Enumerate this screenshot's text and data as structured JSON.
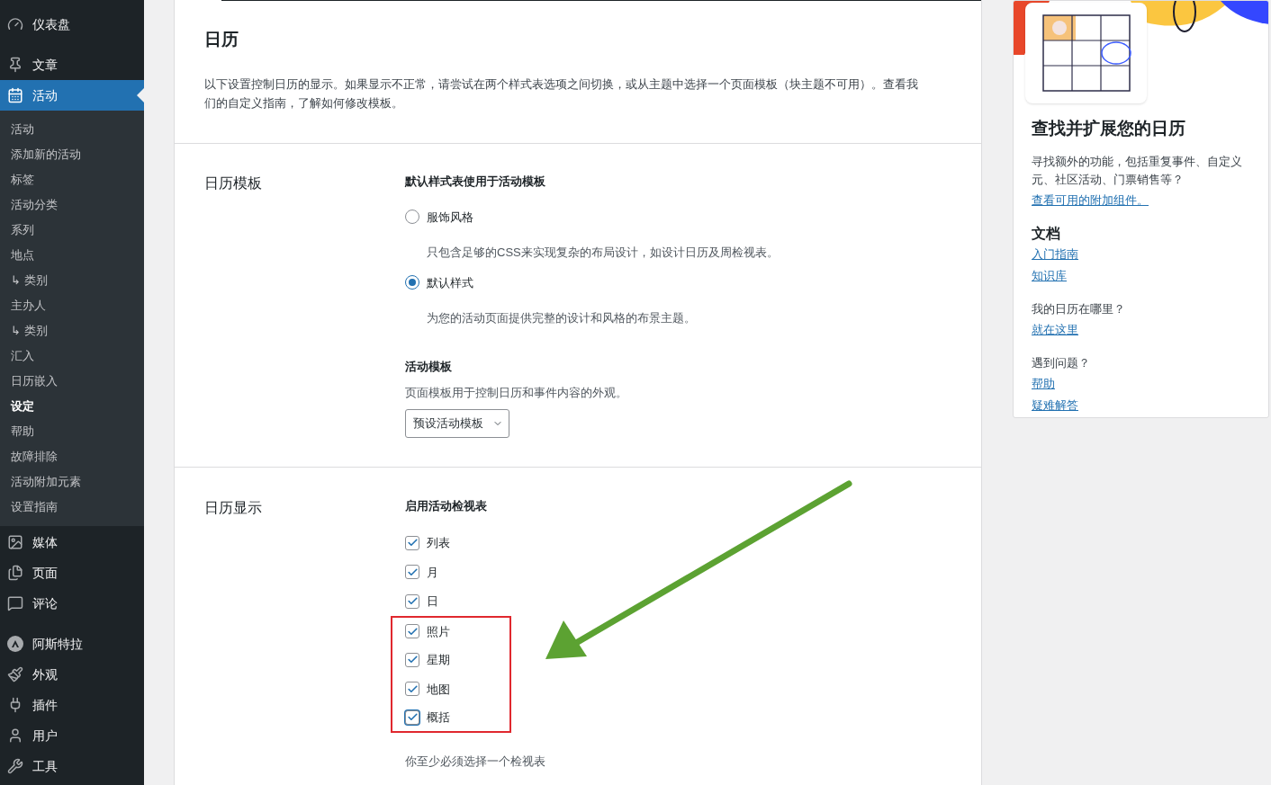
{
  "sidebar": {
    "menu_before": [
      {
        "label": "仪表盘"
      },
      {
        "label": "文章"
      }
    ],
    "current": {
      "label": "活动",
      "selected": true
    },
    "submenu": [
      {
        "label": "活动",
        "selected": false
      },
      {
        "label": "添加新的活动",
        "selected": false
      },
      {
        "label": "标签",
        "selected": false
      },
      {
        "label": "活动分类",
        "selected": false
      },
      {
        "label": "系列",
        "selected": false
      },
      {
        "label": "地点",
        "selected": false
      },
      {
        "label": "↳ 类别",
        "selected": false
      },
      {
        "label": "主办人",
        "selected": false
      },
      {
        "label": "↳ 类别",
        "selected": false
      },
      {
        "label": "汇入",
        "selected": false
      },
      {
        "label": "日历嵌入",
        "selected": false
      },
      {
        "label": "设定",
        "selected": true
      },
      {
        "label": "帮助",
        "selected": false
      },
      {
        "label": "故障排除",
        "selected": false
      },
      {
        "label": "活动附加元素",
        "selected": false
      },
      {
        "label": "设置指南",
        "selected": false
      }
    ],
    "menu_after": [
      {
        "label": "媒体"
      },
      {
        "label": "页面"
      },
      {
        "label": "评论"
      },
      {
        "label": "阿斯特拉"
      },
      {
        "label": "外观"
      },
      {
        "label": "插件"
      },
      {
        "label": "用户"
      },
      {
        "label": "工具"
      }
    ]
  },
  "header": {
    "title": "日历",
    "description": "以下设置控制日历的显示。如果显示不正常，请尝试在两个样式表选项之间切换，或从主题中选择一个页面模板（块主题不可用）。查看我们的自定义指南，了解如何修改模板。"
  },
  "template_section": {
    "label": "日历模板",
    "heading": "默认样式表使用于活动模板",
    "radios": [
      {
        "label": "服饰风格",
        "description": "只包含足够的CSS来实现复杂的布局设计，如设计日历及周检视表。",
        "selected": false
      },
      {
        "label": "默认样式",
        "description": "为您的活动页面提供完整的设计和风格的布景主题。",
        "selected": true
      }
    ],
    "subheading": "活动模板",
    "hint": "页面模板用于控制日历和事件内容的外观。",
    "select": {
      "value": "预设活动模板"
    }
  },
  "display_section": {
    "label": "日历显示",
    "heading": "启用活动检视表",
    "checkboxes": [
      {
        "label": "列表",
        "checked": true,
        "highlighted": false,
        "focused": false
      },
      {
        "label": "月",
        "checked": true,
        "highlighted": false,
        "focused": false
      },
      {
        "label": "日",
        "checked": true,
        "highlighted": false,
        "focused": false
      },
      {
        "label": "照片",
        "checked": true,
        "highlighted": true,
        "focused": false
      },
      {
        "label": "星期",
        "checked": true,
        "highlighted": true,
        "focused": false
      },
      {
        "label": "地图",
        "checked": true,
        "highlighted": true,
        "focused": false
      },
      {
        "label": "概括",
        "checked": true,
        "highlighted": true,
        "focused": true
      }
    ],
    "note": "你至少必须选择一个检视表"
  },
  "side_card": {
    "title": "查找并扩展您的日历",
    "description": "寻找额外的功能，包括重复事件、自定义元、社区活动、门票销售等？",
    "link": "查看可用的附加组件。",
    "docs_heading": "文档",
    "docs_links": [
      "入门指南",
      "知识库"
    ],
    "groups": [
      {
        "question": "我的日历在哪里？",
        "links": [
          "就在这里"
        ]
      },
      {
        "question": "遇到问题？",
        "links": [
          "帮助",
          "疑难解答"
        ]
      }
    ]
  }
}
